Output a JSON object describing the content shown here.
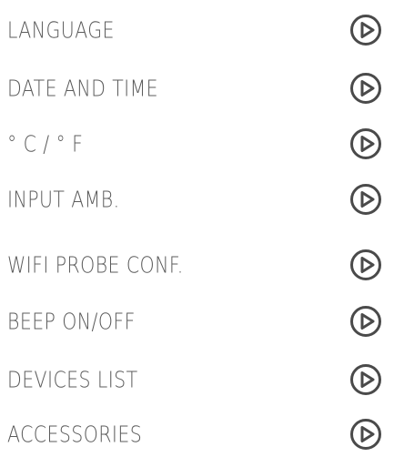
{
  "menu": {
    "items": [
      {
        "label": "LANGUAGE",
        "icon": "play-circle-icon"
      },
      {
        "label": "DATE AND TIME",
        "icon": "play-circle-icon"
      },
      {
        "label": "° C / ° F",
        "icon": "play-circle-icon"
      },
      {
        "label": "INPUT AMB.",
        "icon": "play-circle-icon"
      },
      {
        "label": "WIFI PROBE CONF.",
        "icon": "play-circle-icon"
      },
      {
        "label": "BEEP ON/OFF",
        "icon": "play-circle-icon"
      },
      {
        "label": "DEVICES LIST",
        "icon": "play-circle-icon"
      },
      {
        "label": "ACCESSORIES",
        "icon": "play-circle-icon"
      }
    ]
  },
  "colors": {
    "text": "#5b5b5b",
    "icon": "#4a4a4a",
    "background": "#ffffff"
  }
}
